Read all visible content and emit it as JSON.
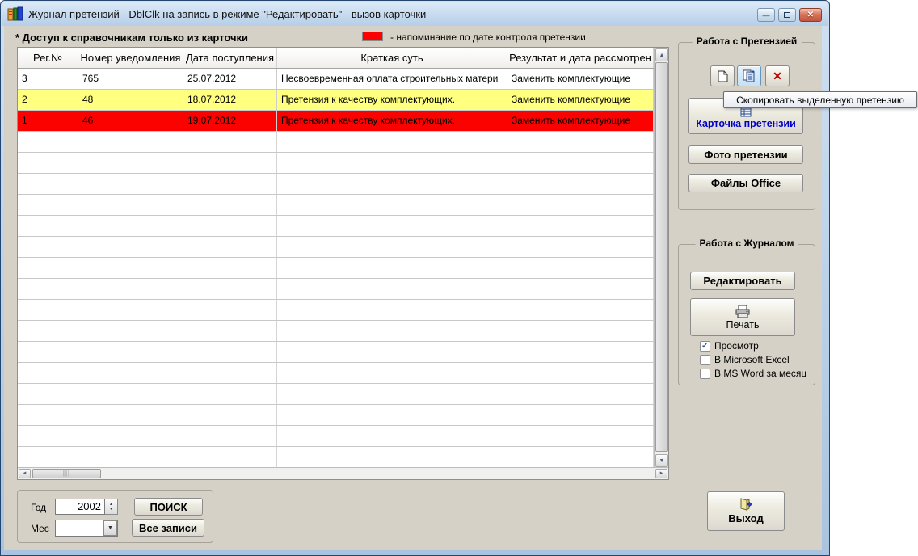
{
  "window": {
    "title": "Журнал претензий - DblClk на запись в режиме \"Редактировать\" - вызов карточки"
  },
  "icons": {
    "minimize": "—",
    "close": "✕",
    "delete": "✕",
    "check": "✓",
    "spin_up": "▲",
    "spin_down": "▼",
    "dropdown": "▼",
    "scroll_left": "◄",
    "scroll_right": "►",
    "scroll_up": "▲",
    "scroll_down": "▼",
    "grip": "|||"
  },
  "header": {
    "note": "* Доступ к справочникам только из карточки",
    "legend_text": "- напоминание по дате контроля претензии",
    "legend_color": "#ff0000"
  },
  "table": {
    "columns": [
      "Рег.№",
      "Номер уведомления",
      "Дата поступления",
      "Краткая суть",
      "Результат и дата рассмотрен"
    ],
    "rows": [
      {
        "reg": "3",
        "num": "765",
        "date": "25.07.2012",
        "essence": "Несвоевременная оплата строительных матери",
        "result": "Заменить комплектующие",
        "bg": "#ffffff",
        "fg": "#000000"
      },
      {
        "reg": "2",
        "num": "48",
        "date": "18.07.2012",
        "essence": "Претензия к качеству комплектующих.",
        "result": "Заменить комплектующие",
        "bg": "#ffff80",
        "fg": "#000000"
      },
      {
        "reg": "1",
        "num": "46",
        "date": "19.07.2012",
        "essence": "Претензия к качеству комплектующих.",
        "result": "Заменить комплектующие",
        "bg": "#fb0200",
        "fg": "#3a0f0f"
      }
    ]
  },
  "claim_panel": {
    "title": "Работа с Претензией",
    "tooltip": "Скопировать выделенную претензию",
    "card_button": "Карточка претензии",
    "photo_button": "Фото претензии",
    "office_button": "Файлы Office"
  },
  "journal_panel": {
    "title": "Работа с Журналом",
    "edit_button": "Редактировать",
    "print_button": "Печать",
    "checkboxes": [
      {
        "label": "Просмотр",
        "checked": true
      },
      {
        "label": "В Microsoft Excel",
        "checked": false
      },
      {
        "label": "В MS Word за месяц",
        "checked": false
      }
    ]
  },
  "search_panel": {
    "year_label": "Год",
    "year_value": "2002",
    "month_label": "Мес",
    "month_value": "",
    "search_button": "ПОИСК",
    "all_records_button": "Все записи"
  },
  "exit_button": "Выход"
}
